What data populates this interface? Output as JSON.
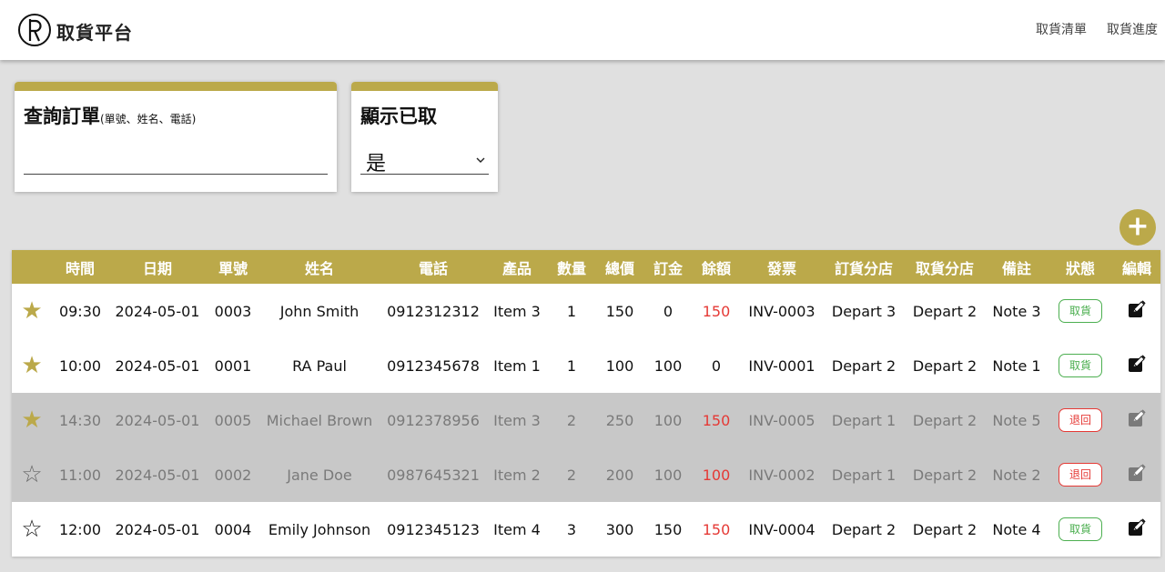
{
  "header": {
    "brand": "取貨平台",
    "nav": [
      "取貨清單",
      "取貨進度"
    ]
  },
  "search_card": {
    "title": "查詢訂單",
    "hint": "(單號、姓名、電話)",
    "value": ""
  },
  "filter_card": {
    "title": "顯示已取",
    "selected": "是"
  },
  "colors": {
    "accent": "#bba94a",
    "muted_row": "#c8c8c8",
    "alert_red": "#e53935",
    "ok_green": "#4caf50"
  },
  "table": {
    "columns": [
      "",
      "時間",
      "日期",
      "單號",
      "姓名",
      "電話",
      "產品",
      "數量",
      "總價",
      "訂金",
      "餘額",
      "發票",
      "訂貨分店",
      "取貨分店",
      "備註",
      "狀態",
      "編輯"
    ],
    "rows": [
      {
        "starred": true,
        "muted": false,
        "time": "09:30",
        "date": "2024-05-01",
        "order_no": "0003",
        "name": "John Smith",
        "phone": "0912312312",
        "product": "Item 3",
        "qty": "1",
        "total": "150",
        "deposit": "0",
        "balance": "150",
        "balance_alert": true,
        "invoice": "INV-0003",
        "order_branch": "Depart 3",
        "pickup_branch": "Depart 2",
        "note": "Note 3",
        "status": "取貨",
        "status_type": "pickup"
      },
      {
        "starred": true,
        "muted": false,
        "time": "10:00",
        "date": "2024-05-01",
        "order_no": "0001",
        "name": "RA Paul",
        "phone": "0912345678",
        "product": "Item 1",
        "qty": "1",
        "total": "100",
        "deposit": "100",
        "balance": "0",
        "balance_alert": false,
        "invoice": "INV-0001",
        "order_branch": "Depart 2",
        "pickup_branch": "Depart 2",
        "note": "Note 1",
        "status": "取貨",
        "status_type": "pickup"
      },
      {
        "starred": true,
        "muted": true,
        "time": "14:30",
        "date": "2024-05-01",
        "order_no": "0005",
        "name": "Michael Brown",
        "phone": "0912378956",
        "product": "Item 3",
        "qty": "2",
        "total": "250",
        "deposit": "100",
        "balance": "150",
        "balance_alert": true,
        "invoice": "INV-0005",
        "order_branch": "Depart 1",
        "pickup_branch": "Depart 2",
        "note": "Note 5",
        "status": "退回",
        "status_type": "return"
      },
      {
        "starred": false,
        "muted": true,
        "time": "11:00",
        "date": "2024-05-01",
        "order_no": "0002",
        "name": "Jane Doe",
        "phone": "0987645321",
        "product": "Item 2",
        "qty": "2",
        "total": "200",
        "deposit": "100",
        "balance": "100",
        "balance_alert": true,
        "invoice": "INV-0002",
        "order_branch": "Depart 1",
        "pickup_branch": "Depart 2",
        "note": "Note 2",
        "status": "退回",
        "status_type": "return"
      },
      {
        "starred": false,
        "muted": false,
        "time": "12:00",
        "date": "2024-05-01",
        "order_no": "0004",
        "name": "Emily Johnson",
        "phone": "0912345123",
        "product": "Item 4",
        "qty": "3",
        "total": "300",
        "deposit": "150",
        "balance": "150",
        "balance_alert": true,
        "invoice": "INV-0004",
        "order_branch": "Depart 2",
        "pickup_branch": "Depart 2",
        "note": "Note 4",
        "status": "取貨",
        "status_type": "pickup"
      }
    ]
  }
}
